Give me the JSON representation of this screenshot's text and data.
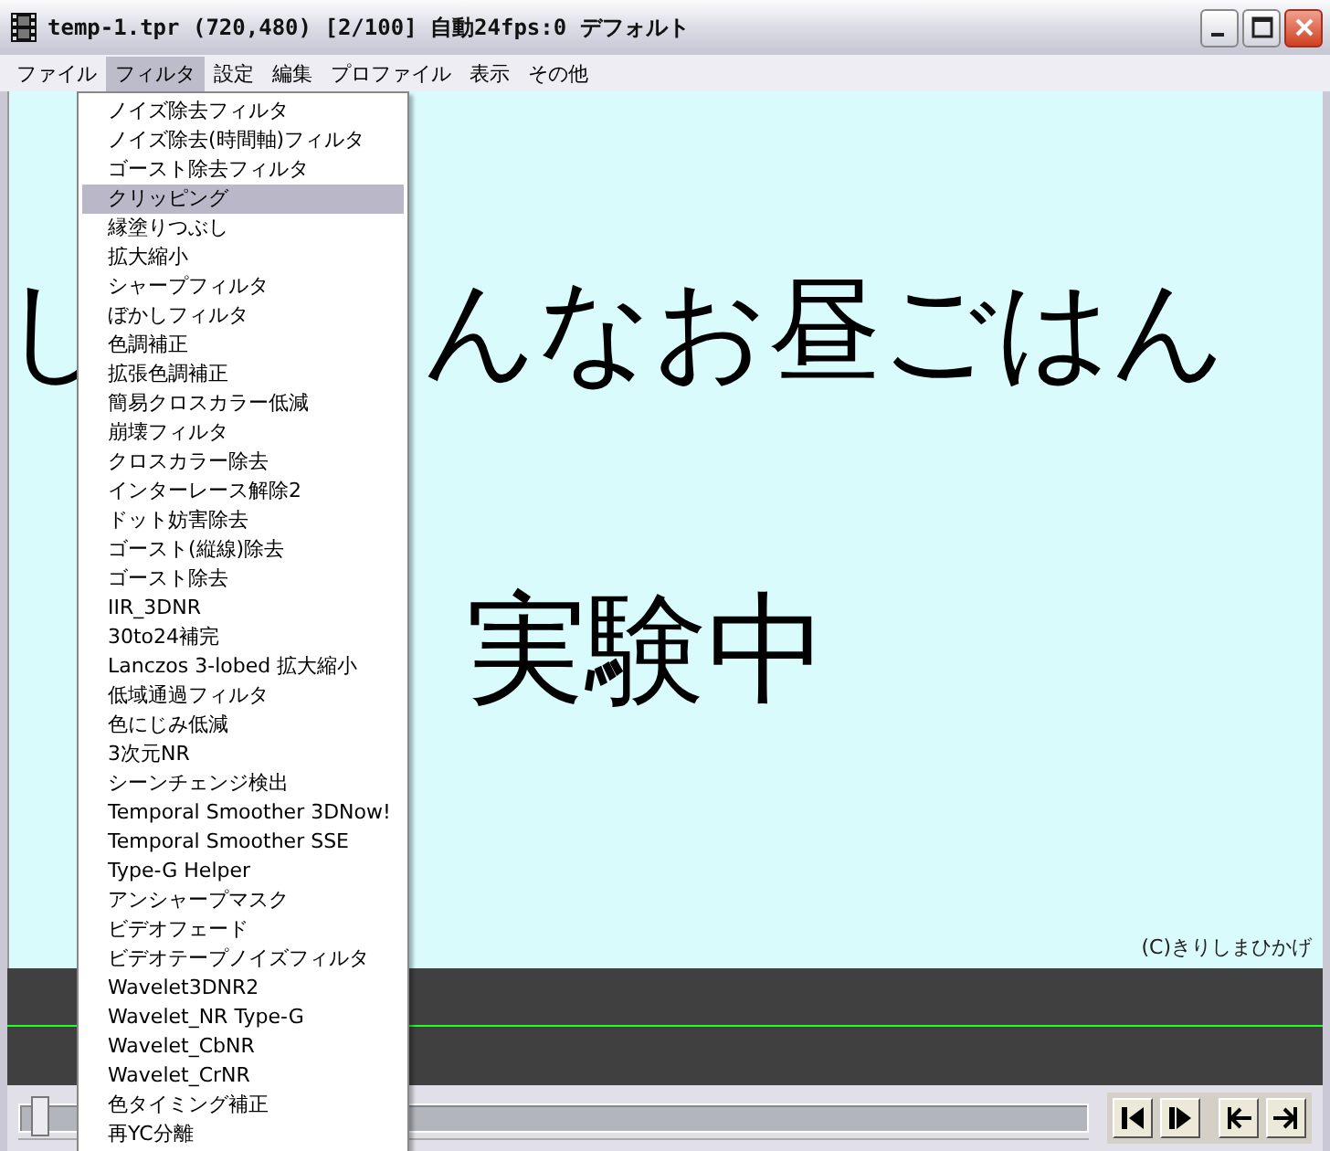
{
  "window": {
    "title": "temp-1.tpr (720,480) [2/100] 自動24fps:0 デフォルト"
  },
  "menu_bar": [
    {
      "label": "ファイル",
      "selected": false
    },
    {
      "label": "フィルタ",
      "selected": true
    },
    {
      "label": "設定",
      "selected": false
    },
    {
      "label": "編集",
      "selected": false
    },
    {
      "label": "プロファイル",
      "selected": false
    },
    {
      "label": "表示",
      "selected": false
    },
    {
      "label": "その他",
      "selected": false
    }
  ],
  "filter_menu": [
    {
      "label": "ノイズ除去フィルタ",
      "selected": false
    },
    {
      "label": "ノイズ除去(時間軸)フィルタ",
      "selected": false
    },
    {
      "label": "ゴースト除去フィルタ",
      "selected": false
    },
    {
      "label": "クリッピング",
      "selected": true
    },
    {
      "label": "縁塗りつぶし",
      "selected": false
    },
    {
      "label": "拡大縮小",
      "selected": false
    },
    {
      "label": "シャープフィルタ",
      "selected": false
    },
    {
      "label": "ぼかしフィルタ",
      "selected": false
    },
    {
      "label": "色調補正",
      "selected": false
    },
    {
      "label": "拡張色調補正",
      "selected": false
    },
    {
      "label": "簡易クロスカラー低減",
      "selected": false
    },
    {
      "label": "崩壊フィルタ",
      "selected": false
    },
    {
      "label": "クロスカラー除去",
      "selected": false
    },
    {
      "label": "インターレース解除2",
      "selected": false
    },
    {
      "label": "ドット妨害除去",
      "selected": false
    },
    {
      "label": "ゴースト(縦線)除去",
      "selected": false
    },
    {
      "label": "ゴースト除去",
      "selected": false
    },
    {
      "label": "IIR_3DNR",
      "selected": false
    },
    {
      "label": "30to24補完",
      "selected": false
    },
    {
      "label": "Lanczos 3-lobed 拡大縮小",
      "selected": false
    },
    {
      "label": "低域通過フィルタ",
      "selected": false
    },
    {
      "label": "色にじみ低減",
      "selected": false
    },
    {
      "label": "3次元NR",
      "selected": false
    },
    {
      "label": "シーンチェンジ検出",
      "selected": false
    },
    {
      "label": "Temporal Smoother 3DNow!",
      "selected": false
    },
    {
      "label": "Temporal Smoother SSE",
      "selected": false
    },
    {
      "label": "Type-G Helper",
      "selected": false
    },
    {
      "label": "アンシャープマスク",
      "selected": false
    },
    {
      "label": "ビデオフェード",
      "selected": false
    },
    {
      "label": "ビデオテープノイズフィルタ",
      "selected": false
    },
    {
      "label": "Wavelet3DNR2",
      "selected": false
    },
    {
      "label": "Wavelet_NR Type-G",
      "selected": false
    },
    {
      "label": "Wavelet_CbNR",
      "selected": false
    },
    {
      "label": "Wavelet_CrNR",
      "selected": false
    },
    {
      "label": "色タイミング補正",
      "selected": false
    },
    {
      "label": "再YC分離",
      "selected": false
    }
  ],
  "preview": {
    "headline_left": "し",
    "headline_right": "んなお昼ごはん",
    "caption": "実験中",
    "credit": "(C)きりしまひかげ"
  },
  "seek_slider": {
    "level": 0.01
  }
}
